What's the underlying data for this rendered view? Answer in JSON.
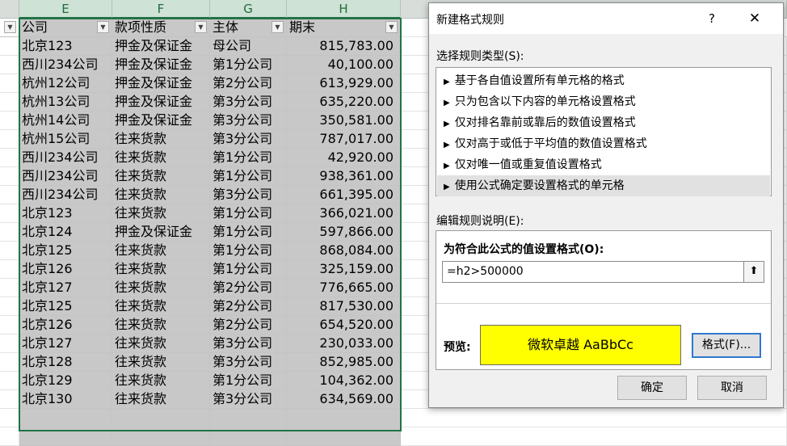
{
  "sheet": {
    "column_headers": [
      "E",
      "F",
      "G",
      "H"
    ],
    "field_headers": [
      "公司",
      "款项性质",
      "主体",
      "期末"
    ],
    "filter_glyph": "▼",
    "rows": [
      [
        "北京123",
        "押金及保证金",
        "母公司",
        "815,783.00"
      ],
      [
        "西川234公司",
        "押金及保证金",
        "第1分公司",
        "40,100.00"
      ],
      [
        "杭州12公司",
        "押金及保证金",
        "第2分公司",
        "613,929.00"
      ],
      [
        "杭州13公司",
        "押金及保证金",
        "第3分公司",
        "635,220.00"
      ],
      [
        "杭州14公司",
        "押金及保证金",
        "第3分公司",
        "350,581.00"
      ],
      [
        "杭州15公司",
        "往来货款",
        "第3分公司",
        "787,017.00"
      ],
      [
        "西川234公司",
        "往来货款",
        "第1分公司",
        "42,920.00"
      ],
      [
        "西川234公司",
        "往来货款",
        "第1分公司",
        "938,361.00"
      ],
      [
        "西川234公司",
        "往来货款",
        "第3分公司",
        "661,395.00"
      ],
      [
        "北京123",
        "往来货款",
        "第1分公司",
        "366,021.00"
      ],
      [
        "北京124",
        "押金及保证金",
        "第1分公司",
        "597,866.00"
      ],
      [
        "北京125",
        "往来货款",
        "第1分公司",
        "868,084.00"
      ],
      [
        "北京126",
        "往来货款",
        "第1分公司",
        "325,159.00"
      ],
      [
        "北京127",
        "往来货款",
        "第2分公司",
        "776,665.00"
      ],
      [
        "北京125",
        "往来货款",
        "第2分公司",
        "817,530.00"
      ],
      [
        "北京126",
        "往来货款",
        "第2分公司",
        "654,520.00"
      ],
      [
        "北京127",
        "往来货款",
        "第3分公司",
        "230,033.00"
      ],
      [
        "北京128",
        "往来货款",
        "第3分公司",
        "852,985.00"
      ],
      [
        "北京129",
        "往来货款",
        "第1分公司",
        "104,362.00"
      ],
      [
        "北京130",
        "往来货款",
        "第3分公司",
        "634,569.00"
      ]
    ]
  },
  "dialog": {
    "title": "新建格式规则",
    "help_glyph": "?",
    "close_glyph": "✕",
    "rule_type_label": "选择规则类型(S):",
    "rule_types": [
      "基于各自值设置所有单元格的格式",
      "只为包含以下内容的单元格设置格式",
      "仅对排名靠前或靠后的数值设置格式",
      "仅对高于或低于平均值的数值设置格式",
      "仅对唯一值或重复值设置格式",
      "使用公式确定要设置格式的单元格"
    ],
    "selected_rule_index": 5,
    "edit_desc_label": "编辑规则说明(E):",
    "formula_label": "为符合此公式的值设置格式(O):",
    "formula_value": "=h2>500000",
    "collapse_glyph": "⬆",
    "preview_label": "预览:",
    "preview_text": "微软卓越  AaBbCc",
    "preview_fill": "#ffff00",
    "format_button": "格式(F)...",
    "ok_button": "确定",
    "cancel_button": "取消"
  }
}
